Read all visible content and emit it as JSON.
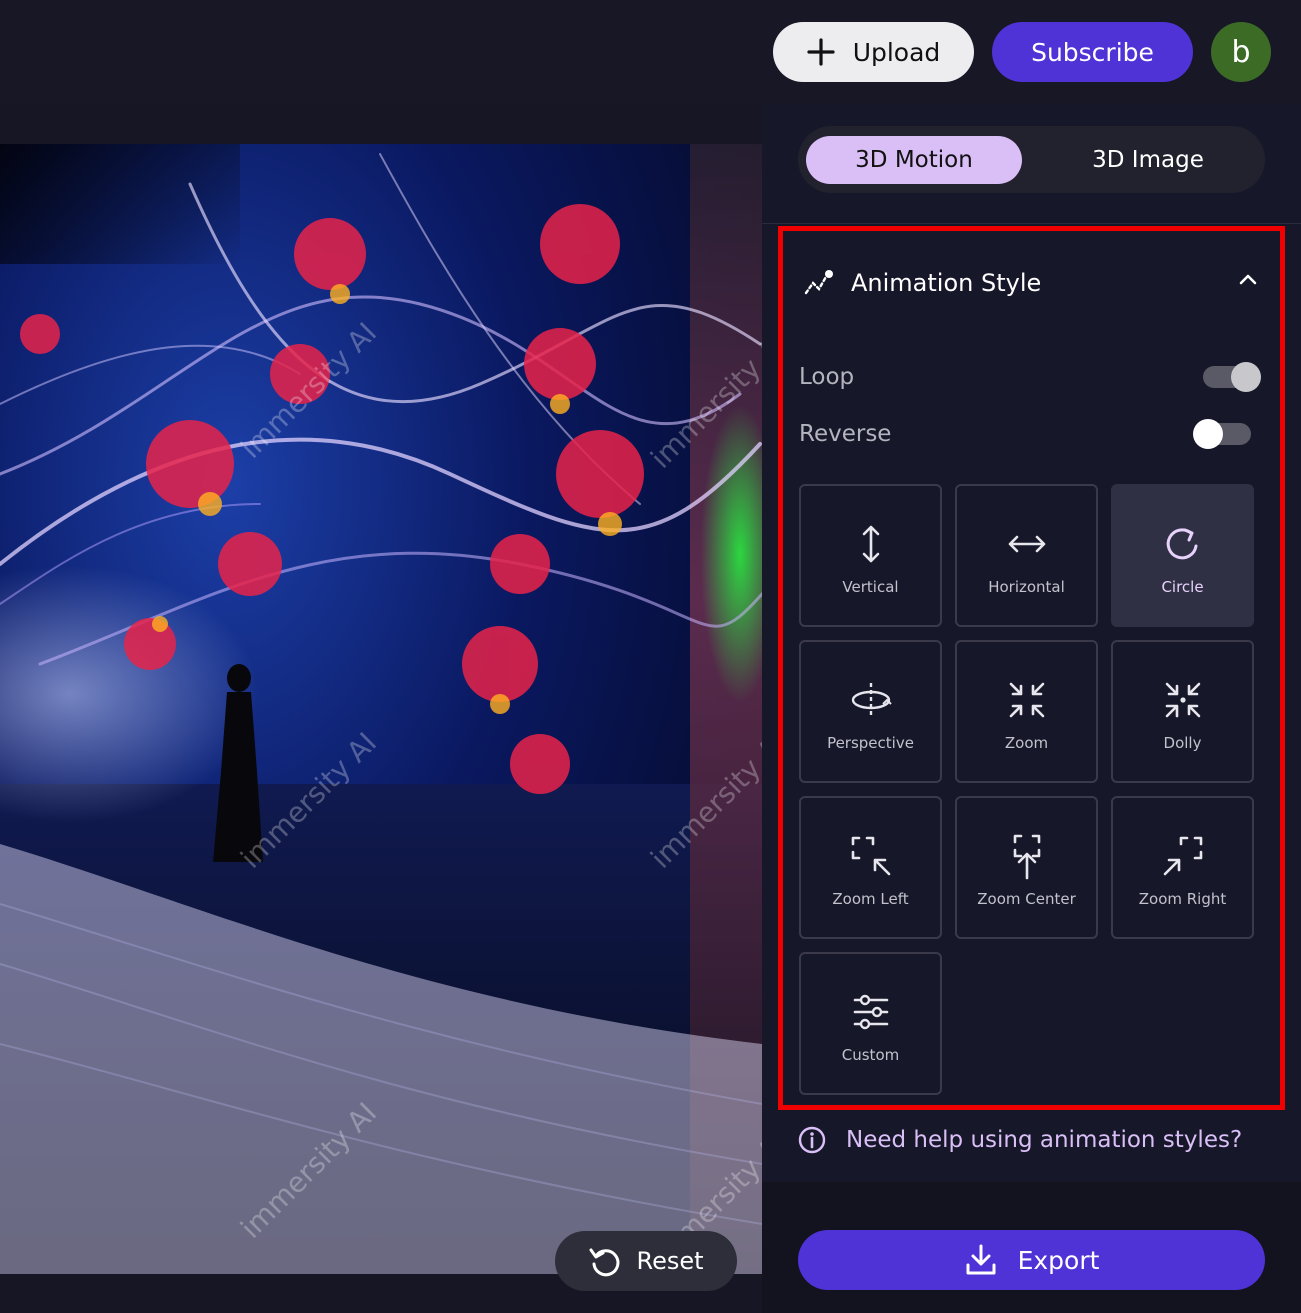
{
  "topbar": {
    "upload_label": "Upload",
    "subscribe_label": "Subscribe",
    "avatar_letter": "b"
  },
  "canvas": {
    "reset_label": "Reset",
    "watermark_text": "immersity AI"
  },
  "panel": {
    "tabs": [
      {
        "label": "3D Motion",
        "active": true
      },
      {
        "label": "3D Image",
        "active": false
      }
    ],
    "section": {
      "title": "Animation Style",
      "icon": "motion-path-icon",
      "expanded": true,
      "loop": {
        "label": "Loop",
        "on": true
      },
      "reverse": {
        "label": "Reverse",
        "on": false
      },
      "styles": [
        {
          "label": "Vertical",
          "icon": "vertical-arrows-icon",
          "selected": false
        },
        {
          "label": "Horizontal",
          "icon": "horizontal-arrows-icon",
          "selected": false
        },
        {
          "label": "Circle",
          "icon": "circle-arrow-icon",
          "selected": true
        },
        {
          "label": "Perspective",
          "icon": "perspective-icon",
          "selected": false
        },
        {
          "label": "Zoom",
          "icon": "zoom-icon",
          "selected": false
        },
        {
          "label": "Dolly",
          "icon": "dolly-icon",
          "selected": false
        },
        {
          "label": "Zoom Left",
          "icon": "zoom-left-icon",
          "selected": false
        },
        {
          "label": "Zoom Center",
          "icon": "zoom-center-icon",
          "selected": false
        },
        {
          "label": "Zoom Right",
          "icon": "zoom-right-icon",
          "selected": false
        },
        {
          "label": "Custom",
          "icon": "sliders-icon",
          "selected": false
        }
      ]
    },
    "help_text": "Need help using animation styles?",
    "export_label": "Export"
  },
  "colors": {
    "accent": "#4f33d6",
    "tab_active": "#d9bff6",
    "highlight_border": "#f00000",
    "avatar": "#3c6b26"
  }
}
